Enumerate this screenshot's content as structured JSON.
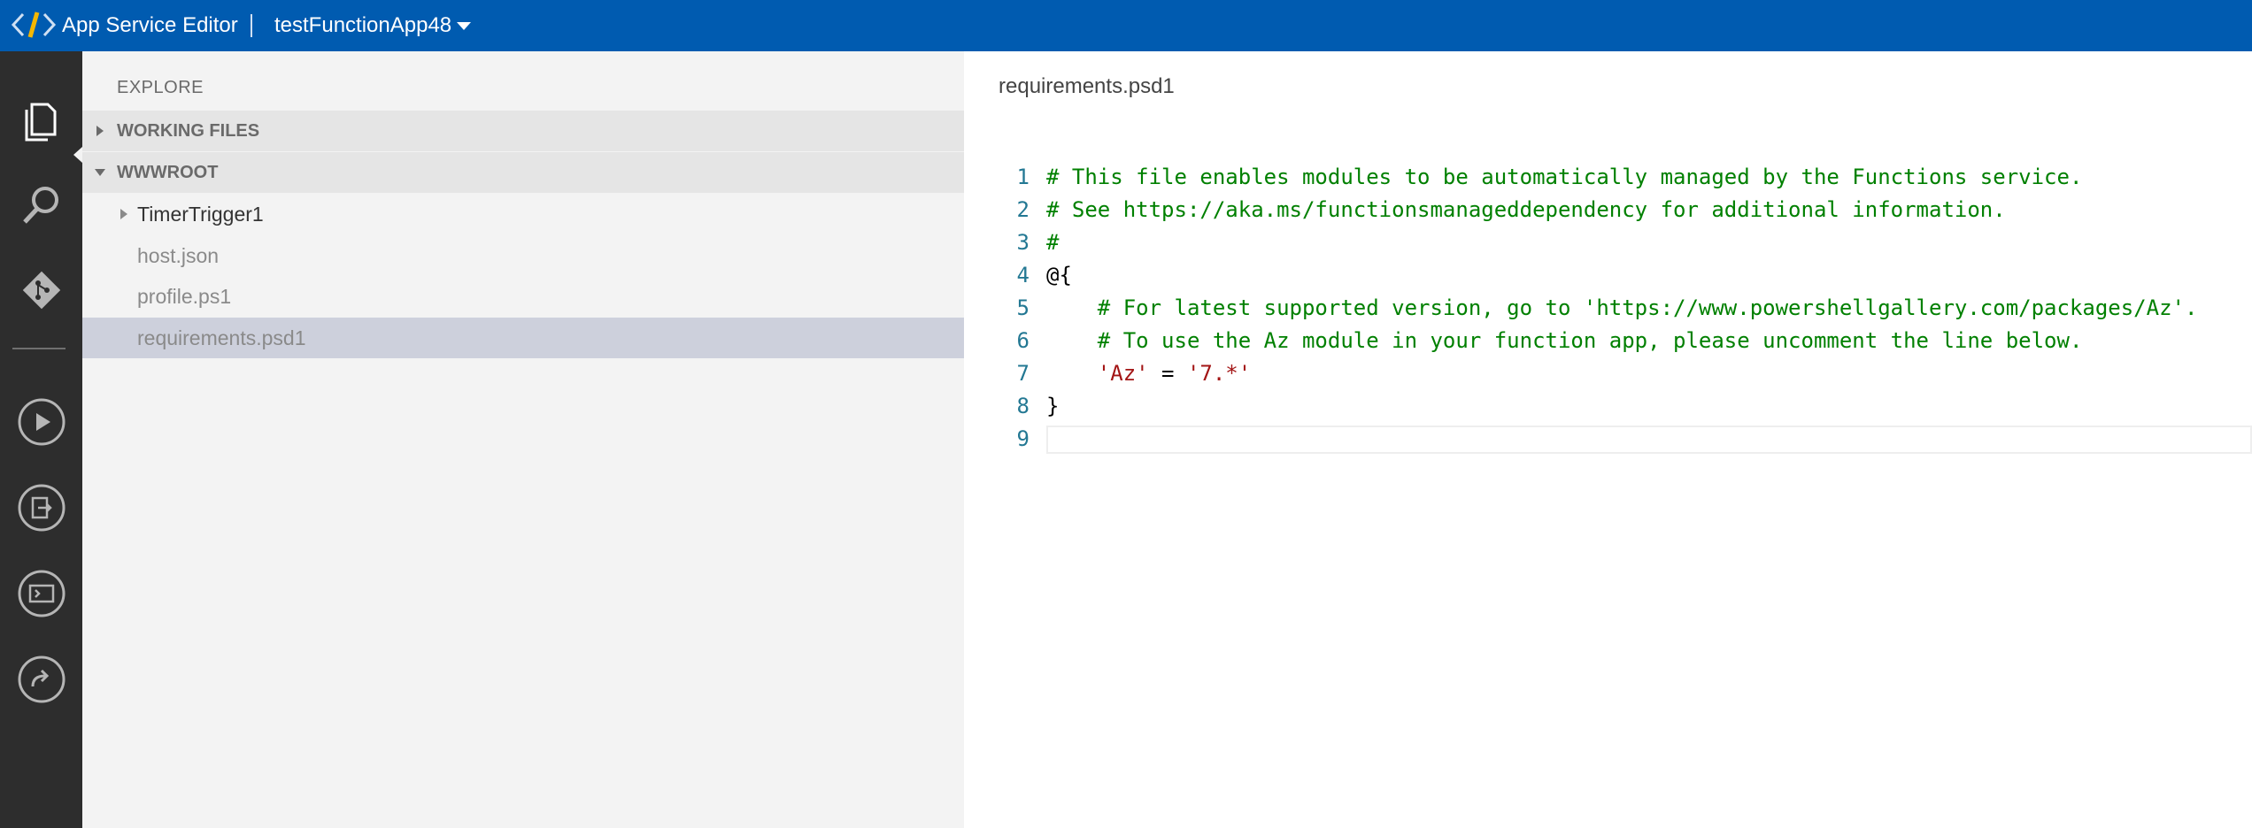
{
  "titlebar": {
    "app_name": "App Service Editor",
    "site_name": "testFunctionApp48",
    "brand_color": "#005bb0"
  },
  "activitybar": {
    "items": [
      {
        "icon": "files-icon",
        "active": true
      },
      {
        "icon": "search-icon"
      },
      {
        "icon": "git-icon"
      },
      {
        "icon": "run-icon"
      },
      {
        "icon": "output-icon"
      },
      {
        "icon": "console-icon"
      },
      {
        "icon": "open-site-icon"
      }
    ]
  },
  "explorer": {
    "title": "EXPLORE",
    "working_files": "WORKING FILES",
    "root": "WWWROOT",
    "items": [
      {
        "label": "TimerTrigger1",
        "type": "folder"
      },
      {
        "label": "host.json",
        "type": "file"
      },
      {
        "label": "profile.ps1",
        "type": "file"
      },
      {
        "label": "requirements.psd1",
        "type": "file",
        "selected": true
      }
    ]
  },
  "editor": {
    "filename": "requirements.psd1",
    "lines": [
      {
        "n": "1",
        "text": "# This file enables modules to be automatically managed by the Functions service."
      },
      {
        "n": "2",
        "text": "# See https://aka.ms/functionsmanageddependency for additional information."
      },
      {
        "n": "3",
        "text": "#"
      },
      {
        "n": "4",
        "text": "@{"
      },
      {
        "n": "5",
        "text": "    # For latest supported version, go to 'https://www.powershellgallery.com/packages/Az'."
      },
      {
        "n": "6",
        "text": "    # To use the Az module in your function app, please uncomment the line below."
      },
      {
        "n": "7",
        "indent": "    ",
        "str1": "'Az'",
        "eq": " = ",
        "str2": "'7.*'"
      },
      {
        "n": "8",
        "text": "}"
      },
      {
        "n": "9",
        "text": ""
      }
    ],
    "colors": {
      "comment": "#008000",
      "string": "#a31515",
      "line_number": "#237893"
    }
  }
}
